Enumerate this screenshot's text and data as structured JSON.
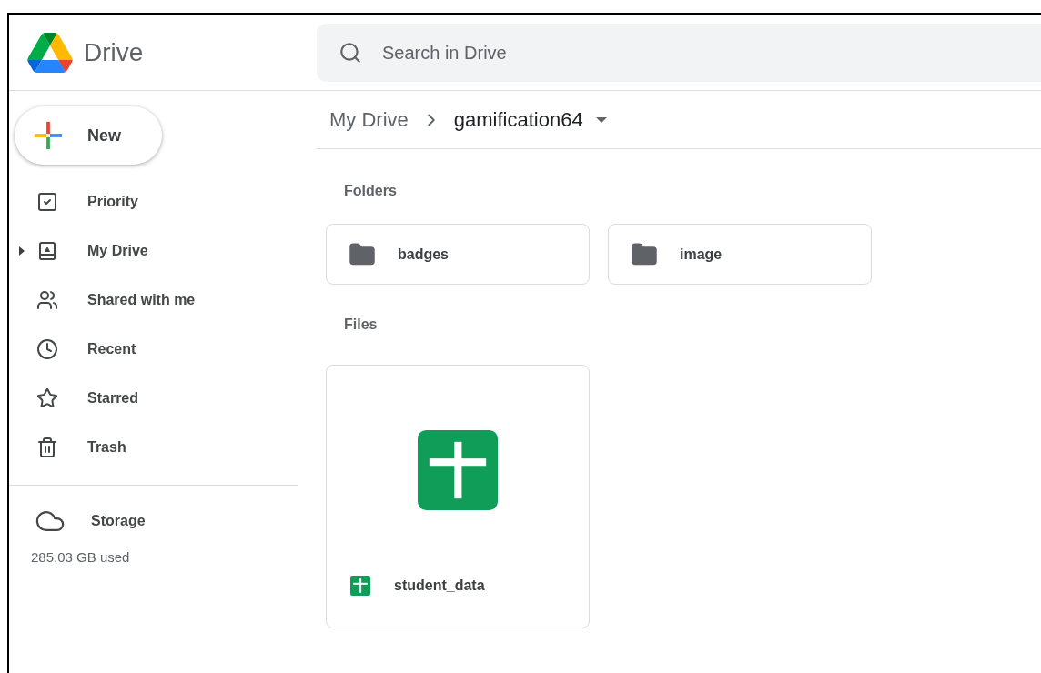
{
  "header": {
    "app_name": "Drive",
    "search": {
      "placeholder": "Search in Drive"
    }
  },
  "sidebar": {
    "new_button": "New",
    "items": [
      {
        "label": "Priority",
        "expandable": false
      },
      {
        "label": "My Drive",
        "expandable": true
      },
      {
        "label": "Shared with me",
        "expandable": false
      },
      {
        "label": "Recent",
        "expandable": false
      },
      {
        "label": "Starred",
        "expandable": false
      },
      {
        "label": "Trash",
        "expandable": false
      }
    ],
    "storage": {
      "label": "Storage",
      "usage": "285.03 GB used"
    }
  },
  "breadcrumb": [
    "My Drive",
    "gamification64"
  ],
  "folders_heading": "Folders",
  "folders": [
    "badges",
    "image"
  ],
  "files_heading": "Files",
  "files": [
    {
      "name": "student_data"
    }
  ]
}
